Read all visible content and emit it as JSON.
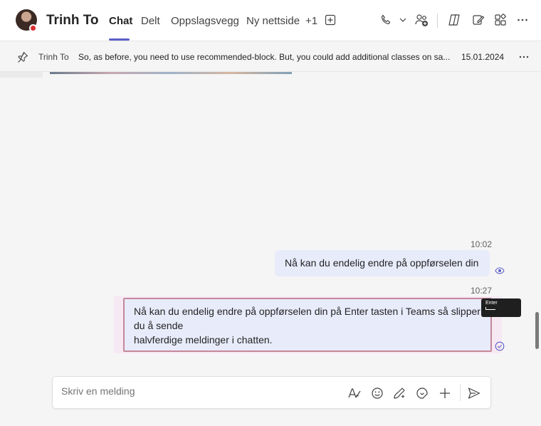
{
  "header": {
    "title": "Trinh To",
    "tabs": [
      {
        "label": "Chat",
        "active": true
      },
      {
        "label": "Delt"
      },
      {
        "label": "Oppslagsvegg"
      },
      {
        "label": "Ny nettside"
      },
      {
        "label": "+1"
      }
    ],
    "icons": [
      "add-tab-icon",
      "phone-icon",
      "chevron-down-icon",
      "people-add-icon",
      "copilot-icon",
      "edit-icon",
      "apps-icon",
      "more-icon"
    ],
    "status_color": "#d92c2c",
    "accent_color": "#5b5fc7"
  },
  "pinned": {
    "author": "Trinh To",
    "text": "So, as before, you need to use recommended-block. But, you could add additional classes on sa...",
    "date": "15.01.2024"
  },
  "messages": [
    {
      "time": "10:02",
      "text": "Nå kan du endelig endre på oppførselen din",
      "status": "seen"
    },
    {
      "time": "10:27",
      "lines": [
        "Nå kan du endelig endre på oppførselen din på Enter tasten i Teams så slipper",
        "du å sende",
        "halvferdige meldinger i chatten."
      ],
      "status": "sent"
    }
  ],
  "tooltip": {
    "label": "Enter"
  },
  "composer": {
    "placeholder": "Skriv en melding",
    "icons": [
      "format-icon",
      "emoji-icon",
      "loop-icon",
      "sticker-icon",
      "plus-icon",
      "send-icon"
    ]
  }
}
